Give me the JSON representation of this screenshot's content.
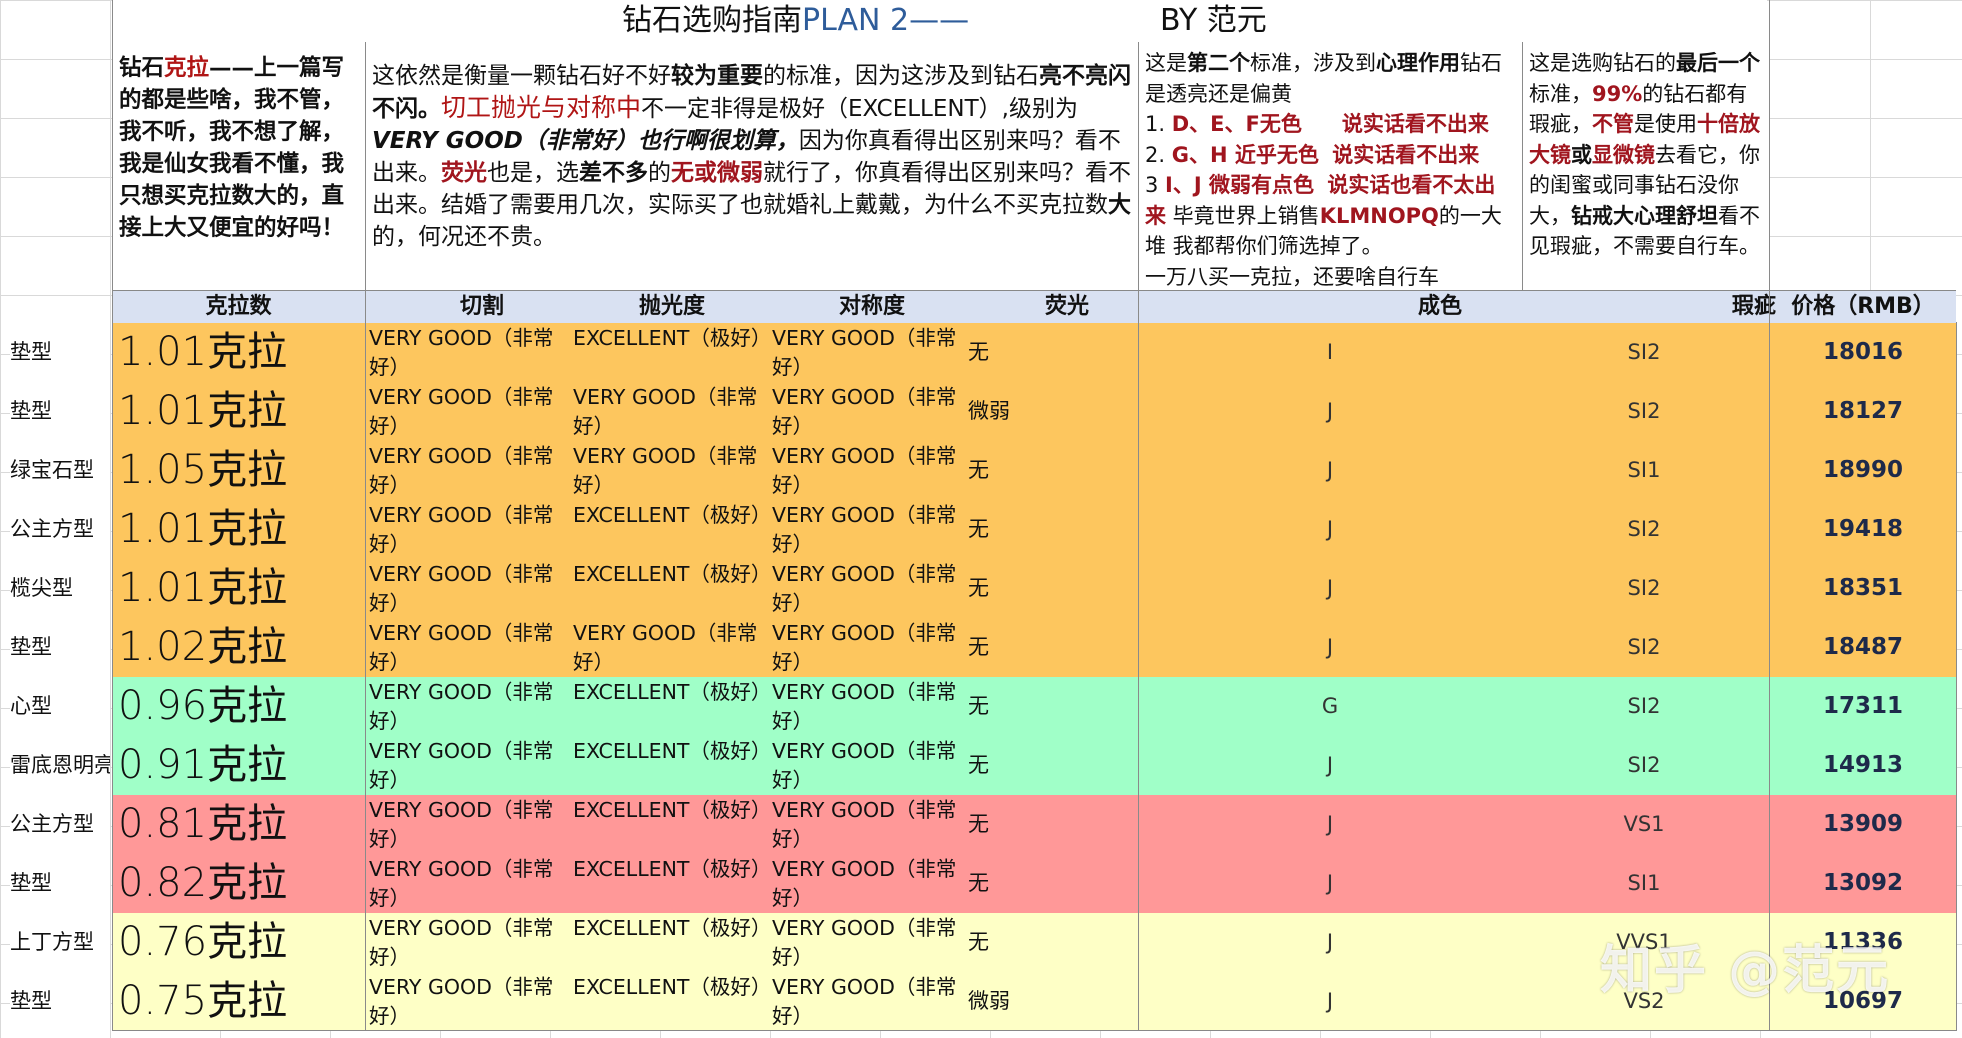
{
  "title": {
    "main": "钻石选购指南",
    "plan": "PLAN 2——",
    "by": "BY 范元"
  },
  "desc1": {
    "p1": "钻石",
    "p2": "克拉",
    "p3": "——上一篇写的都是些啥，我不管，我不听，我不想了解，我是仙女我看不懂，我只想买克拉数大的，直接上大又便宜的好吗！"
  },
  "desc2": {
    "s1": "这依然是衡量一颗钻石好不好",
    "s2": "较为重要",
    "s3": "的标准，因为这涉及到钻石",
    "s4": "亮不亮闪不闪。",
    "s5": "切工抛光与对称中",
    "s6": "不一定非得是极好（EXCELLENT）,级别为",
    "s7": "VERY GOOD（非常好）也行啊很划算，",
    "s8": "因为你真看得出区别来吗？看不出来。",
    "s9": "荧光",
    "s10": "也是，选",
    "s11": "差不多",
    "s12": "的",
    "s13": "无或微弱",
    "s14": "就行了，你真看得出区别来吗？看不出来。结婚了需要用几次，实际买了也就婚礼上戴戴，为什么不买克拉数",
    "s15": "大",
    "s16": "的，何况还不贵。"
  },
  "desc3": {
    "a1": "这是",
    "a2": "第二个",
    "a3": "标准，涉及到",
    "a4": "心理作用",
    "a5": "钻石是透亮还是偏黄",
    "l1a": "1. ",
    "l1b": "D、E、F无色",
    "l1c": "说实话看不出来",
    "l2a": "2. ",
    "l2b": "G、H 近乎无色",
    "l2c": "说实话看不出来",
    "l3a": "3  ",
    "l3b": "I、J 微弱有点色",
    "l3c": "说实话也看不太出来",
    "l3d": " 毕竟世界上销售",
    "l3e": "KLMNOPQ",
    "l3f": "的一大堆 我都帮你们筛选掉了。",
    "last": "一万八买一克拉，还要啥自行车"
  },
  "desc4": {
    "b1": "这是选购钻石的",
    "b2": "最后一个",
    "b3": "标准，",
    "b4": "99%",
    "b5": "的钻石都有瑕疵，",
    "b6": "不管",
    "b7": "是使用",
    "b8": "十倍放大镜",
    "b9": "或",
    "b10": "显微镜",
    "b11": "去看它，你的闺蜜或同事钻石没你大，",
    "b12": "钻戒大心理舒坦",
    "b13": "看不见瑕疵，不需要自行车。"
  },
  "headers": {
    "carat": "克拉数",
    "cut": "切割",
    "polish": "抛光度",
    "symmetry": "对称度",
    "fluorescence": "荧光",
    "color": "成色",
    "clarity": "瑕疵",
    "price": "价格（RMB）"
  },
  "colors": {
    "orange": "#fdc65e",
    "green": "#a0ffc8",
    "red": "#ff9898",
    "yellow": "#feffc6",
    "header": "#d9e1f2"
  },
  "rows": [
    {
      "shape": "垫型",
      "carat": "1.01克拉",
      "cut": "VERY GOOD（非常好）",
      "polish": "EXCELLENT（极好）",
      "symmetry": "VERY GOOD（非常好）",
      "fluo": "无",
      "color": "I",
      "clarity": "SI2",
      "price": "18016",
      "band": "orange"
    },
    {
      "shape": "垫型",
      "carat": "1.01克拉",
      "cut": "VERY GOOD（非常好）",
      "polish": "VERY GOOD（非常好）",
      "symmetry": "VERY GOOD（非常好）",
      "fluo": "微弱",
      "color": "J",
      "clarity": "SI2",
      "price": "18127",
      "band": "orange"
    },
    {
      "shape": "绿宝石型",
      "carat": "1.05克拉",
      "cut": "VERY GOOD（非常好）",
      "polish": "VERY GOOD（非常好）",
      "symmetry": "VERY GOOD（非常好）",
      "fluo": "无",
      "color": "J",
      "clarity": "SI1",
      "price": "18990",
      "band": "orange"
    },
    {
      "shape": "公主方型",
      "carat": "1.01克拉",
      "cut": "VERY GOOD（非常好）",
      "polish": "EXCELLENT（极好）",
      "symmetry": "VERY GOOD（非常好）",
      "fluo": "无",
      "color": "J",
      "clarity": "SI2",
      "price": "19418",
      "band": "orange"
    },
    {
      "shape": "榄尖型",
      "carat": "1.01克拉",
      "cut": "VERY GOOD（非常好）",
      "polish": "EXCELLENT（极好）",
      "symmetry": "VERY GOOD（非常好）",
      "fluo": "无",
      "color": "J",
      "clarity": "SI2",
      "price": "18351",
      "band": "orange"
    },
    {
      "shape": "垫型",
      "carat": "1.02克拉",
      "cut": "VERY GOOD（非常好）",
      "polish": "VERY GOOD（非常好）",
      "symmetry": "VERY GOOD（非常好）",
      "fluo": "无",
      "color": "J",
      "clarity": "SI2",
      "price": "18487",
      "band": "orange"
    },
    {
      "shape": "心型",
      "carat": "0.96克拉",
      "cut": "VERY GOOD（非常好）",
      "polish": "EXCELLENT（极好）",
      "symmetry": "VERY GOOD（非常好）",
      "fluo": "无",
      "color": "G",
      "clarity": "SI2",
      "price": "17311",
      "band": "green"
    },
    {
      "shape": "雷底恩明亮",
      "carat": "0.91克拉",
      "cut": "VERY GOOD（非常好）",
      "polish": "EXCELLENT（极好）",
      "symmetry": "VERY GOOD（非常好）",
      "fluo": "无",
      "color": "J",
      "clarity": "SI2",
      "price": "14913",
      "band": "green"
    },
    {
      "shape": "公主方型",
      "carat": "0.81克拉",
      "cut": "VERY GOOD（非常好）",
      "polish": "EXCELLENT（极好）",
      "symmetry": "VERY GOOD（非常好）",
      "fluo": "无",
      "color": "J",
      "clarity": "VS1",
      "price": "13909",
      "band": "red"
    },
    {
      "shape": "垫型",
      "carat": "0.82克拉",
      "cut": "VERY GOOD（非常好）",
      "polish": "EXCELLENT（极好）",
      "symmetry": "VERY GOOD（非常好）",
      "fluo": "无",
      "color": "J",
      "clarity": "SI1",
      "price": "13092",
      "band": "red"
    },
    {
      "shape": "上丁方型",
      "carat": "0.76克拉",
      "cut": "VERY GOOD（非常好）",
      "polish": "EXCELLENT（极好）",
      "symmetry": "VERY GOOD（非常好）",
      "fluo": "无",
      "color": "J",
      "clarity": "VVS1",
      "price": "11336",
      "band": "yellow"
    },
    {
      "shape": "垫型",
      "carat": "0.75克拉",
      "cut": "VERY GOOD（非常好）",
      "polish": "EXCELLENT（极好）",
      "symmetry": "VERY GOOD（非常好）",
      "fluo": "微弱",
      "color": "J",
      "clarity": "VS2",
      "price": "10697",
      "band": "yellow"
    }
  ],
  "watermark": "知乎 @范元"
}
